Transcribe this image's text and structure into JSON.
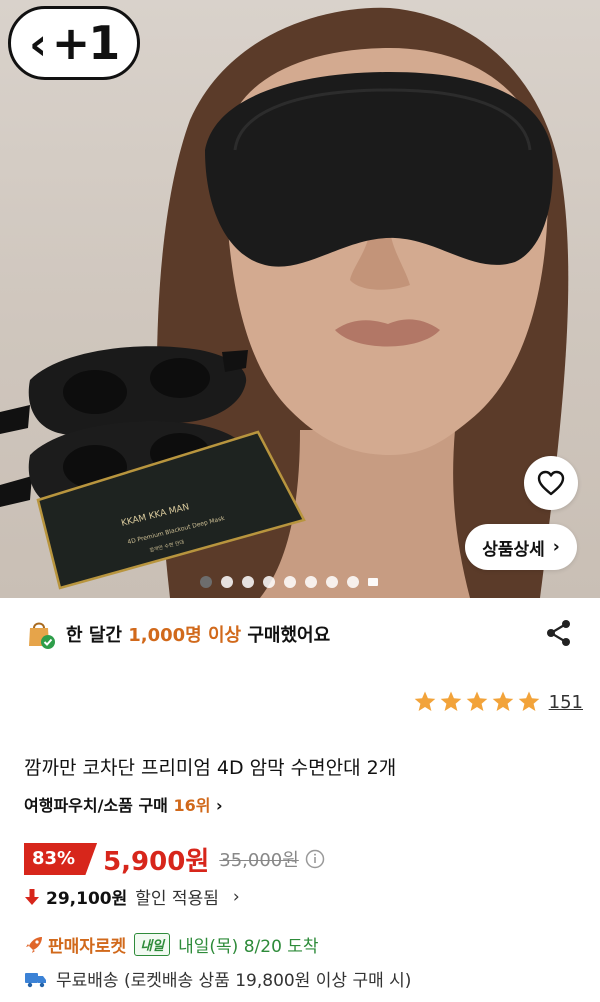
{
  "badge": {
    "label": "+1",
    "back_glyph": "‹"
  },
  "detail_button": {
    "label": "상품상세",
    "chevron": "›"
  },
  "carousel": {
    "count": 9,
    "active_index": 0
  },
  "product_box": {
    "brand": "KKAM KKA MAN",
    "line1": "4D Premium Blackout Deep Mask",
    "line2": "깜까만 수면 안대"
  },
  "purchase": {
    "prefix": "한 달간 ",
    "highlight": "1,000명 이상",
    "suffix": " 구매했어요"
  },
  "rating": {
    "stars": 5,
    "count": "151"
  },
  "product": {
    "title": "깜까만 코차단 프리미엄 4D 암막 수면안대 2개",
    "rank_prefix": "여행파우치/소품 구매 ",
    "rank_value": "16위",
    "rank_chevron": "›"
  },
  "price": {
    "discount": "83%",
    "sale": "5,900원",
    "original": "35,000원"
  },
  "coupon": {
    "arrow": "🡇",
    "amount": "29,100원",
    "text": "할인 적용됨",
    "chevron": "›"
  },
  "delivery": {
    "rocket": "판매자로켓",
    "chip": "내일",
    "eta": "내일(목) 8/20 도착"
  },
  "shipping": {
    "text": "무료배송 (로켓배송 상품 19,800원 이상 구매 시)"
  },
  "colors": {
    "accent": "#d1691b",
    "sale_red": "#d7261b",
    "green": "#2e8b3a",
    "star": "#f2a33a"
  }
}
